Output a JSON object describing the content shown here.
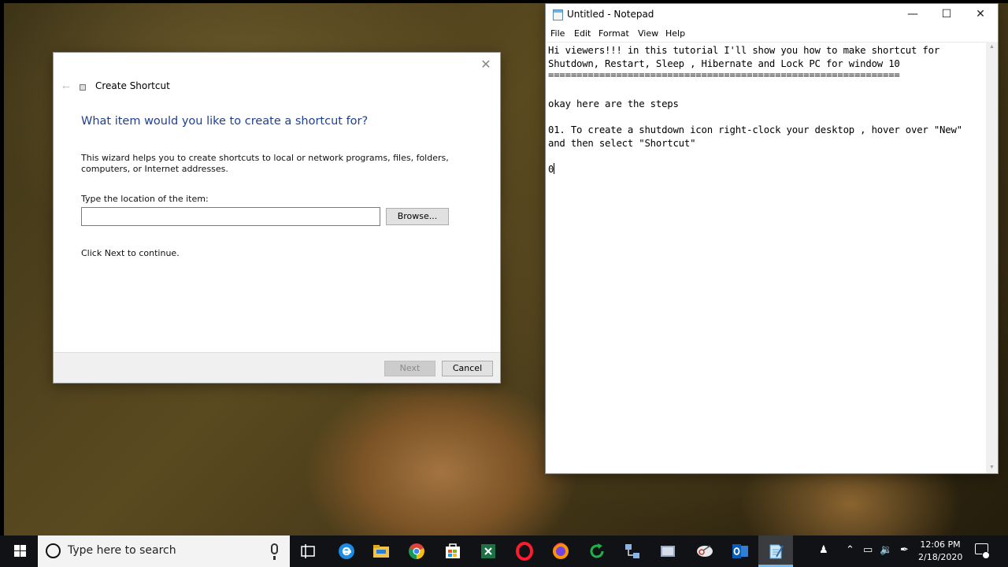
{
  "dialog": {
    "title": "Create Shortcut",
    "heading": "What item would you like to create a shortcut for?",
    "description": "This wizard helps you to create shortcuts to local or network programs, files, folders, computers, or Internet addresses.",
    "location_label": "Type the location of the item:",
    "location_value": "",
    "browse_label": "Browse...",
    "continue_text": "Click Next to continue.",
    "next_label": "Next",
    "cancel_label": "Cancel",
    "close_glyph": "✕",
    "back_glyph": "←"
  },
  "notepad": {
    "title": "Untitled - Notepad",
    "window_buttons": {
      "minimize": "—",
      "maximize": "☐",
      "close": "✕"
    },
    "menu": [
      "File",
      "Edit",
      "Format",
      "View",
      "Help"
    ],
    "lines": [
      "Hi viewers!!! in this tutorial I'll show you how to make shortcut for",
      "Shutdown, Restart, Sleep , Hibernate and Lock PC for window 10",
      "==============================================================",
      "",
      "okay here are the steps",
      "",
      "01. To create a shutdown icon right-clock your desktop , hover over \"New\"",
      "and then select \"Shortcut\"",
      "",
      "0"
    ]
  },
  "taskbar": {
    "search_placeholder": "Type here to search",
    "pinned_icons": [
      "task-view-icon",
      "edge-icon",
      "file-explorer-icon",
      "chrome-icon",
      "store-icon",
      "excel-icon",
      "opera-icon",
      "firefox-icon",
      "refresh-app-icon",
      "network-app-icon",
      "mail-app-icon",
      "snipping-tool-icon",
      "outlook-icon",
      "notepad-icon"
    ],
    "time": "12:06 PM",
    "date": "2/18/2020",
    "accent_color": "#76b9ed"
  }
}
